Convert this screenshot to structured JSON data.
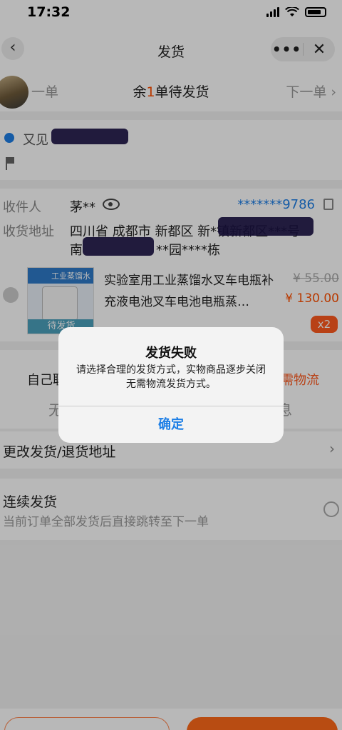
{
  "status_bar": {
    "time": "17:32"
  },
  "nav": {
    "title": "发货",
    "back_icon": "‹",
    "more_icon": "•••",
    "close_icon": "✕"
  },
  "order_nav": {
    "prev_label": "一单",
    "remain_prefix": "余",
    "remain_count": "1",
    "remain_suffix": "单待发货",
    "next_label": "下一单 ›"
  },
  "buyer": {
    "name_prefix": "又见"
  },
  "address": {
    "receiver_label": "收件人",
    "receiver_value": "茅**",
    "phone": "*******9786",
    "address_label": "收货地址",
    "address_line1": "四川省 成都市 新都区 新*镇新都区***号",
    "address_line2": "南                  **园****栋"
  },
  "item": {
    "thumb_band_text": "工业蒸馏水",
    "thumb_tag": "待发货",
    "title": "实验室用工业蒸馏水叉车电瓶补充液电池叉车电池电瓶蒸…",
    "price_old": "¥ 55.00",
    "price": "¥ 130.00",
    "qty": "x2"
  },
  "shipping": {
    "tab_left": "自己联",
    "tab_right": "需物流",
    "under_left": "无",
    "under_right": "息"
  },
  "change_address": {
    "label": "更改发货/退货地址",
    "chevron": "›"
  },
  "continuous": {
    "title": "连续发货",
    "subtitle": "当前订单全部发货后直接跳转至下一单"
  },
  "dialog": {
    "title": "发货失败",
    "message": "请选择合理的发货方式，实物商品逐步关闭无需物流发货方式。",
    "confirm": "确定"
  },
  "colors": {
    "accent": "#ff5a1f",
    "link": "#1e7fe6"
  }
}
